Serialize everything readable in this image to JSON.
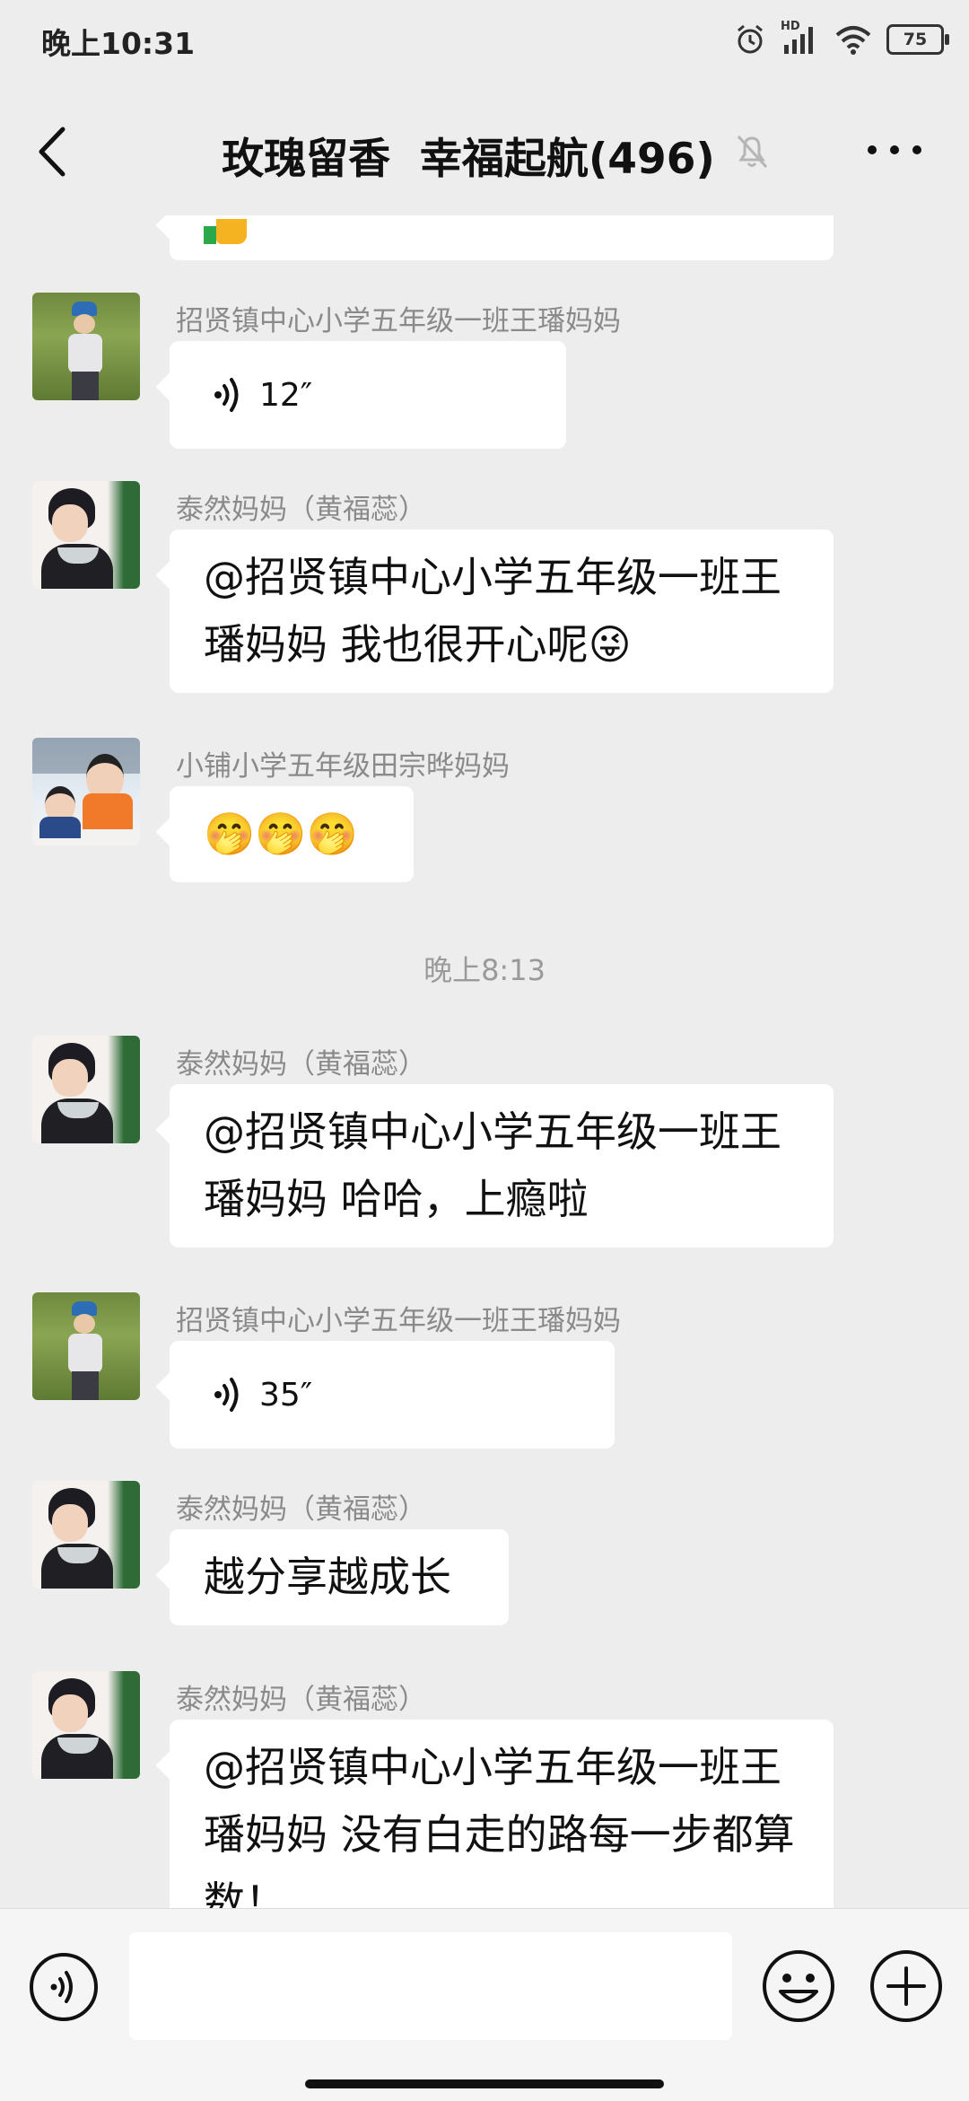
{
  "status": {
    "time": "晚上10:31",
    "battery": "75",
    "network_tag": "HD"
  },
  "header": {
    "title": "玫瑰留香  幸福起航(496)"
  },
  "messages": [
    {
      "sender": "招贤镇中心小学五年级一班王璠妈妈",
      "voice_duration": "12″"
    },
    {
      "sender": "泰然妈妈（黄福蕊）",
      "text": "@招贤镇中心小学五年级一班王璠妈妈  我也很开心呢😜"
    },
    {
      "sender": "小铺小学五年级田宗晔妈妈",
      "text": "🤭🤭🤭"
    },
    {
      "divider": "晚上8:13"
    },
    {
      "sender": "泰然妈妈（黄福蕊）",
      "text": "@招贤镇中心小学五年级一班王璠妈妈  哈哈，上瘾啦"
    },
    {
      "sender": "招贤镇中心小学五年级一班王璠妈妈",
      "voice_duration": "35″"
    },
    {
      "sender": "泰然妈妈（黄福蕊）",
      "text": "越分享越成长"
    },
    {
      "sender": "泰然妈妈（黄福蕊）",
      "text": "@招贤镇中心小学五年级一班王璠妈妈  没有白走的路每一步都算数！"
    }
  ],
  "input": {
    "placeholder": "",
    "value": ""
  },
  "icons": {
    "back": "chevron-left-icon",
    "mute": "bell-muted-icon",
    "more": "more-dots-icon",
    "voice": "voice-wave-icon",
    "emoji": "smiley-icon",
    "plus": "plus-circle-icon"
  },
  "colors": {
    "background": "#ededed",
    "bubble": "#ffffff",
    "sender": "#8a8a8a",
    "divider": "#9a9a9a"
  }
}
